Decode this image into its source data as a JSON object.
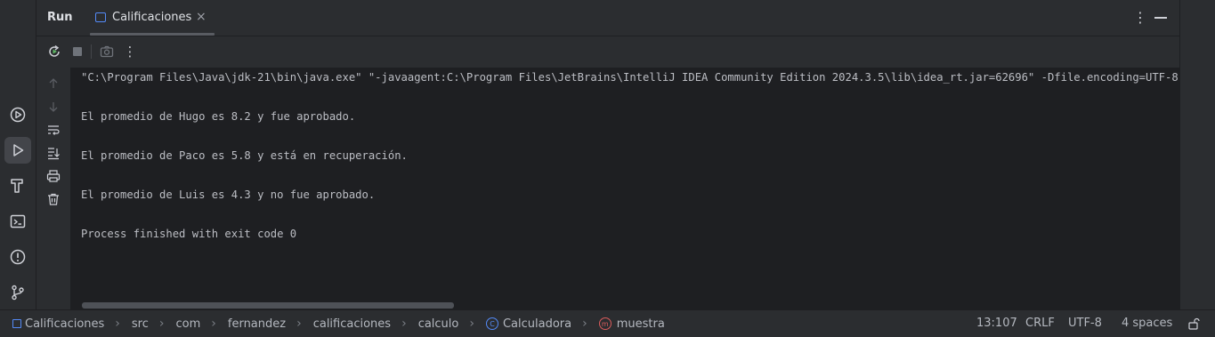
{
  "header": {
    "run_label": "Run",
    "tab_label": "Calificaciones",
    "tab_close": "×",
    "more_glyph": "⋮"
  },
  "toolbar": {
    "more_glyph": "⋮"
  },
  "console": {
    "lines": [
      "\"C:\\Program Files\\Java\\jdk-21\\bin\\java.exe\" \"-javaagent:C:\\Program Files\\JetBrains\\IntelliJ IDEA Community Edition 2024.3.5\\lib\\idea_rt.jar=62696\" -Dfile.encoding=UTF-8",
      "El promedio de Hugo es 8.2 y fue aprobado.",
      "El promedio de Paco es 5.8 y está en recuperación.",
      "El promedio de Luis es 4.3 y no fue aprobado.",
      "Process finished with exit code 0"
    ]
  },
  "breadcrumb": {
    "items": [
      "Calificaciones",
      "src",
      "com",
      "fernandez",
      "calificaciones",
      "calculo",
      "Calculadora",
      "muestra"
    ]
  },
  "status": {
    "position": "13:107",
    "line_sep": "CRLF",
    "encoding": "UTF-8",
    "indent": "4 spaces"
  },
  "colors": {
    "accent": "#548af7",
    "run_green": "#5fb865",
    "console_bg": "#1e1f22",
    "panel_bg": "#2b2d30"
  },
  "icons": {
    "left_strip": [
      "services-icon",
      "run-icon",
      "build-icon",
      "terminal-icon",
      "problems-icon",
      "git-icon"
    ],
    "toolbar": [
      "rerun-icon",
      "stop-icon",
      "screenshot-icon",
      "more-icon"
    ],
    "actions": [
      "up-arrow-icon",
      "down-arrow-icon",
      "soft-wrap-icon",
      "scroll-to-end-icon",
      "print-icon",
      "clear-icon"
    ]
  }
}
